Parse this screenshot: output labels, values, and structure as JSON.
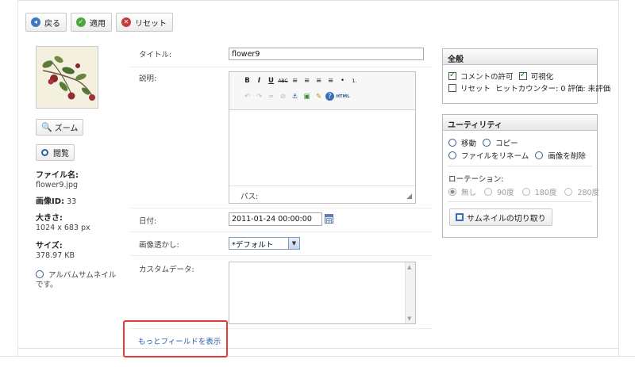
{
  "toolbar": {
    "back_label": "戻る",
    "apply_label": "適用",
    "reset_label": "リセット"
  },
  "left": {
    "zoom_label": "ズーム",
    "view_label": "閲覧",
    "filename_label": "ファイル名:",
    "filename_value": "flower9.jpg",
    "image_id_label": "画像ID:",
    "image_id_value": "33",
    "dimensions_label": "大きさ:",
    "dimensions_value": "1024 x 683 px",
    "size_label": "サイズ:",
    "size_value": "378.97 KB",
    "album_thumb_line1": "アルバムサムネイル",
    "album_thumb_line2": "です。"
  },
  "form": {
    "title_label": "タイトル:",
    "title_value": "flower9",
    "description_label": "説明:",
    "path_label": "パス:",
    "date_label": "日付:",
    "date_value": "2011-01-24 00:00:00",
    "watermark_label": "画像透かし:",
    "watermark_value": "*デフォルト",
    "custom_data_label": "カスタムデータ:",
    "more_fields_link": "もっとフィールドを表示"
  },
  "editor_toolbar": {
    "row1": [
      "B",
      "I",
      "U",
      "ABC",
      "≡",
      "≡",
      "≡",
      "≡",
      "•",
      "1."
    ],
    "row2": [
      "↶",
      "↷",
      "∞",
      "⊘",
      "⚓",
      "▣",
      "✎",
      "?",
      "HTML"
    ]
  },
  "general_panel": {
    "title": "全般",
    "allow_comments_label": "コメントの許可",
    "allow_comments_checked": true,
    "visible_label": "可視化",
    "visible_checked": true,
    "reset_label": "リセット",
    "hit_counter_label": "ヒットカウンター:",
    "hit_counter_value": "0",
    "rating_label": "評価:",
    "rating_value": "未評価"
  },
  "utility_panel": {
    "title": "ユーティリティ",
    "move_label": "移動",
    "copy_label": "コピー",
    "rename_label": "ファイルをリネーム",
    "delete_label": "画像を削除",
    "rotation_label": "ローテーション:",
    "rotation_options": [
      "無し",
      "90度",
      "180度",
      "280度"
    ],
    "crop_thumbnail_label": "サムネイルの切り取り"
  },
  "colors": {
    "link": "#2a5db0",
    "highlight_border": "#e53a3a",
    "panel_header": "#e6e6e6"
  }
}
